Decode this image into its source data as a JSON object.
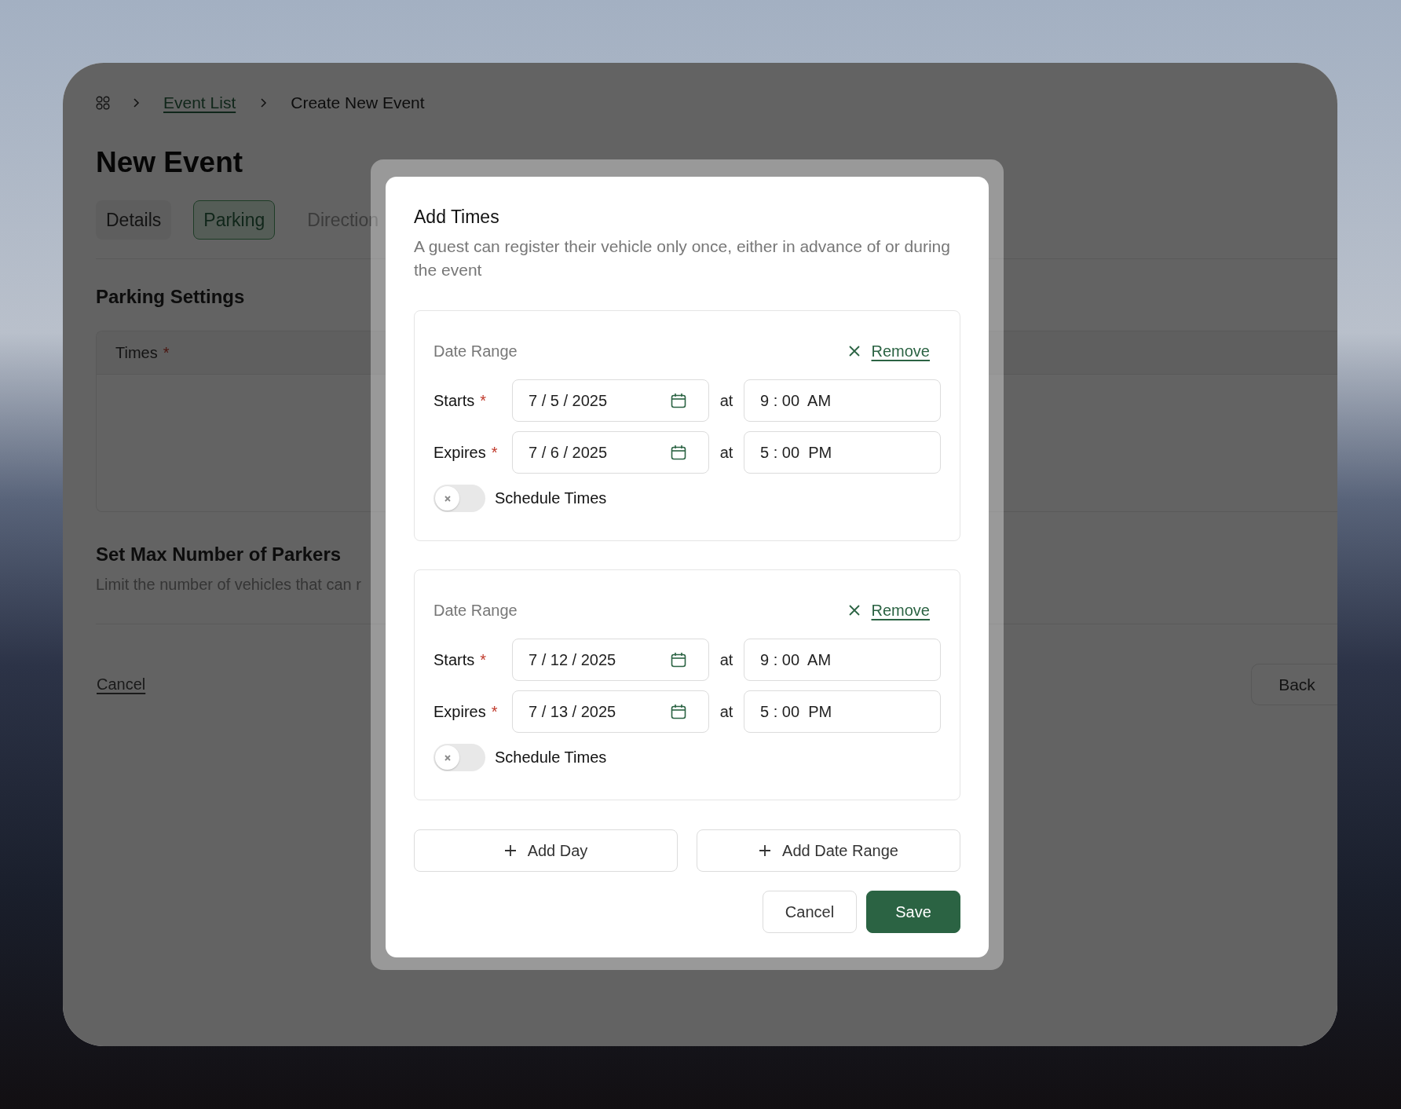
{
  "page": {
    "breadcrumb": [
      {
        "label": "Event List",
        "link": true
      },
      {
        "label": "Create New Event",
        "link": false
      }
    ],
    "title": "New Event",
    "tabs": [
      {
        "label": "Details",
        "selected": false
      },
      {
        "label": "Parking",
        "selected": true
      },
      {
        "label": "Direction",
        "selected": false
      }
    ],
    "section_title": "Parking Settings",
    "times_table": {
      "column": "Times",
      "mark": "*"
    },
    "max_parkers": {
      "title": "Set Max Number of Parkers",
      "description": "Limit the number of vehicles that can r"
    },
    "footer": {
      "cancel": "Cancel",
      "back": "Back"
    }
  },
  "modal": {
    "title": "Add Times",
    "description": "A guest can register their vehicle only once, either in advance of or during the event",
    "date_ranges": [
      {
        "label": "Date Range",
        "remove": "Remove",
        "rows": [
          {
            "label": "Starts",
            "mark": "*",
            "date": "7 / 5 / 2025",
            "at": "at",
            "time": "9 : 00  AM"
          },
          {
            "label": "Expires",
            "mark": "*",
            "date": "7 / 6 / 2025",
            "at": "at",
            "time": "5 : 00  PM"
          }
        ],
        "schedule_times": {
          "label": "Schedule Times",
          "on": false
        }
      },
      {
        "label": "Date Range",
        "remove": "Remove",
        "rows": [
          {
            "label": "Starts",
            "mark": "*",
            "date": "7 / 12 / 2025",
            "at": "at",
            "time": "9 : 00  AM"
          },
          {
            "label": "Expires",
            "mark": "*",
            "date": "7 / 13 / 2025",
            "at": "at",
            "time": "5 : 00  PM"
          }
        ],
        "schedule_times": {
          "label": "Schedule Times",
          "on": false
        }
      }
    ],
    "add_buttons": [
      {
        "label": "Add Day"
      },
      {
        "label": "Add Date Range"
      }
    ],
    "actions": [
      {
        "label": "Cancel",
        "kind": "secondary"
      },
      {
        "label": "Save",
        "kind": "primary"
      }
    ]
  }
}
